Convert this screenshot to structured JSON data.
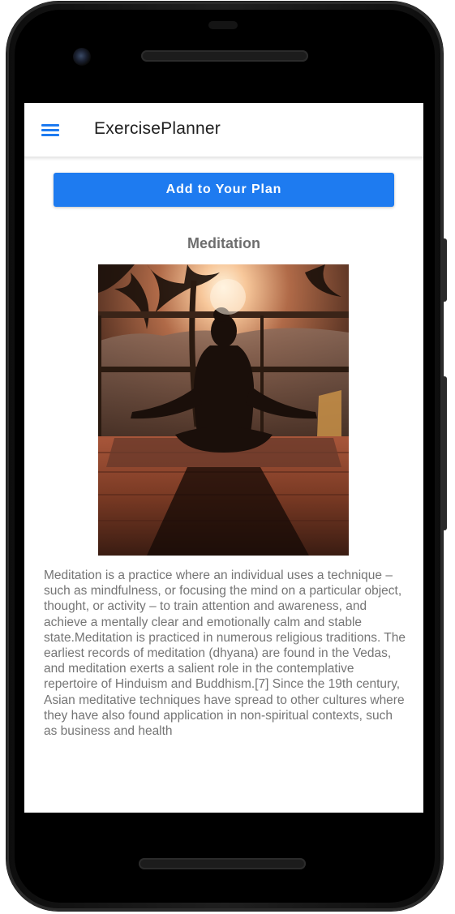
{
  "app": {
    "title": "ExercisePlanner"
  },
  "toolbar": {
    "menu_icon": "hamburger-menu-icon",
    "accent_color": "#1e7bf0"
  },
  "actions": {
    "add_to_plan_label": "Add to Your Plan"
  },
  "exercise": {
    "name": "Meditation",
    "image": "meditation-photo",
    "description": "Meditation is a practice where an individual uses a technique – such as mindfulness, or focusing the mind on a particular object, thought, or activity – to train attention and awareness, and achieve a mentally clear and emotionally calm and stable state.Meditation is practiced in numerous religious traditions. The earliest records of meditation (dhyana) are found in the Vedas, and meditation exerts a salient role in the contemplative repertoire of Hinduism and Buddhism.[7] Since the 19th century, Asian meditative techniques have spread to other cultures where they have also found application in non-spiritual contexts, such as business and health"
  }
}
